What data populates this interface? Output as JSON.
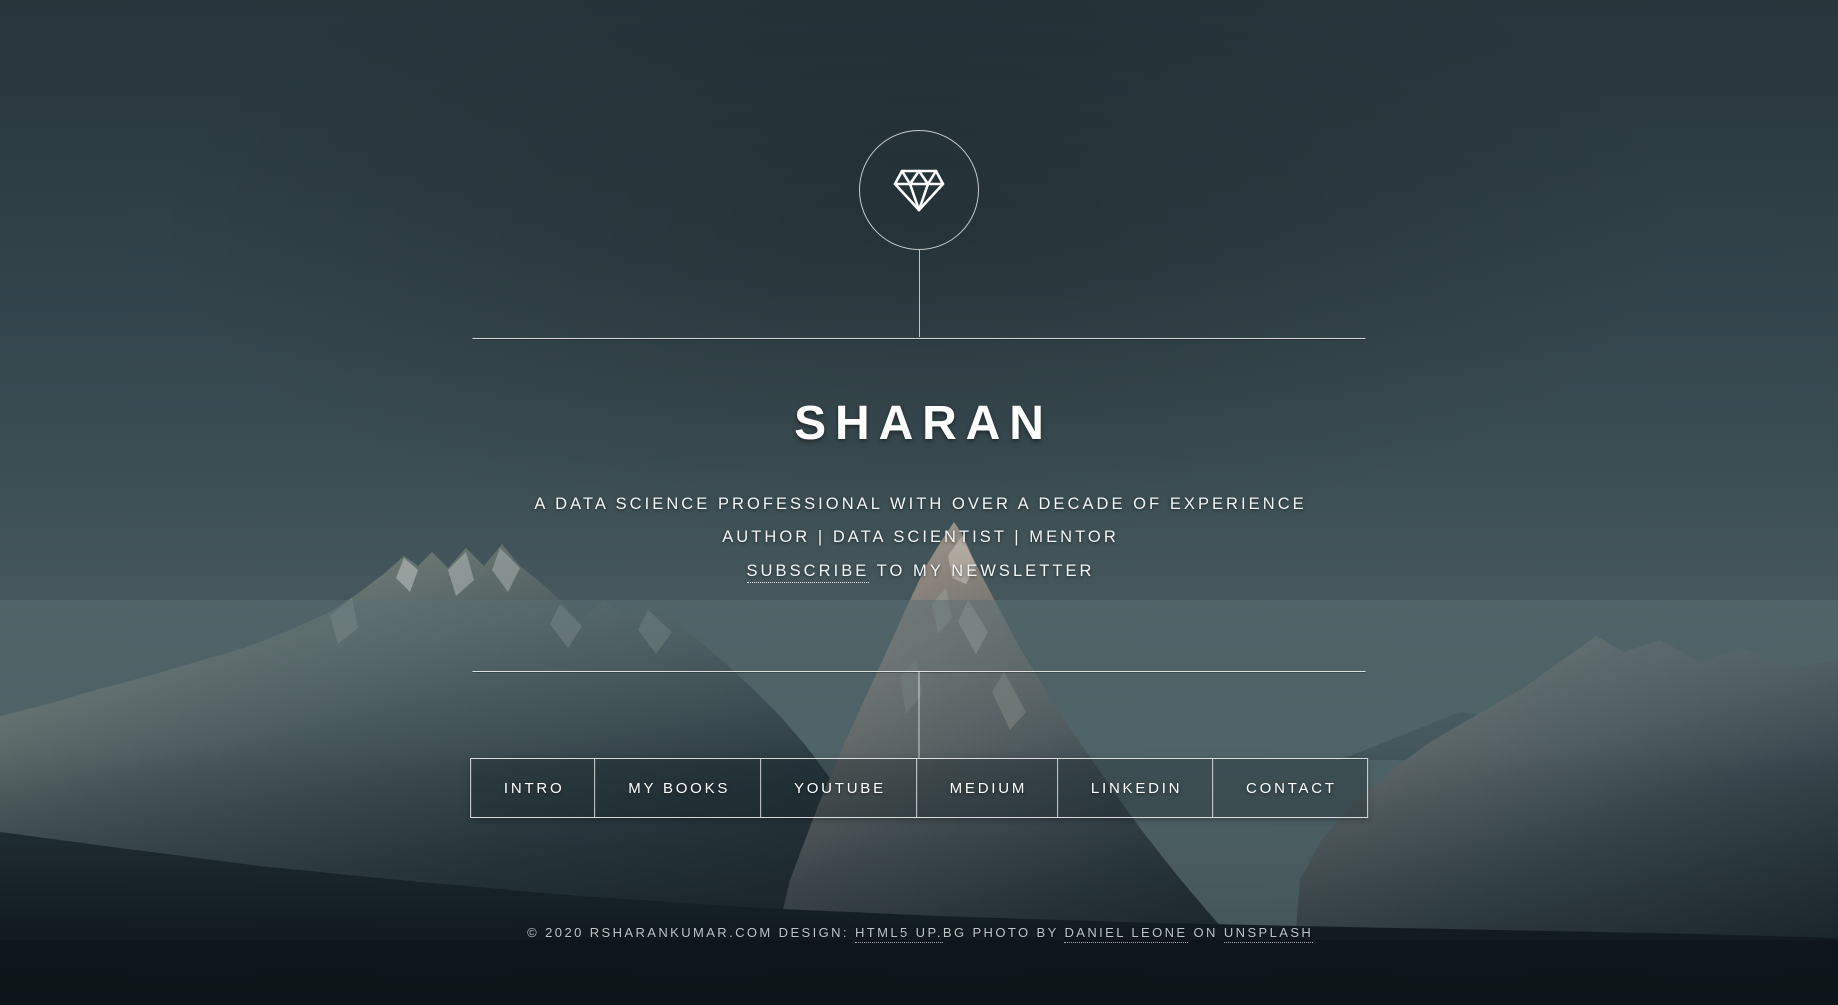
{
  "page": {
    "title": "SHARAN",
    "background_photo": "mountain-range-at-dusk",
    "colors": {
      "sky_top": "#2a3a42",
      "sky_mid": "#4c6166",
      "mountain_dark": "#1c2a30",
      "mountain_light": "#6d7a78",
      "text": "#ffffff",
      "footer_text": "#bcc6c9",
      "rule": "#ffffff"
    }
  },
  "logo": {
    "icon": "diamond-icon",
    "shape": "circle-outline"
  },
  "hero": {
    "heading": "SHARAN",
    "tagline_line1": "A DATA SCIENCE PROFESSIONAL WITH OVER A DECADE OF EXPERIENCE",
    "tagline_line2": "AUTHOR | DATA SCIENTIST | MENTOR",
    "tagline_line3_link": "SUBSCRIBE",
    "tagline_line3_rest": " TO MY NEWSLETTER"
  },
  "nav": {
    "items": [
      {
        "label": "INTRO"
      },
      {
        "label": "MY BOOKS"
      },
      {
        "label": "YOUTUBE"
      },
      {
        "label": "MEDIUM"
      },
      {
        "label": "LINKEDIN"
      },
      {
        "label": "CONTACT"
      }
    ]
  },
  "footer": {
    "copyright": "© 2020 RSHARANKUMAR.COM DESIGN:",
    "design_link": "HTML5 UP.",
    "design_suffix": "BG PHOTO BY",
    "photo_credit_link": "DANIEL LEONE",
    "photo_on": "ON",
    "source_link": "UNSPLASH"
  }
}
